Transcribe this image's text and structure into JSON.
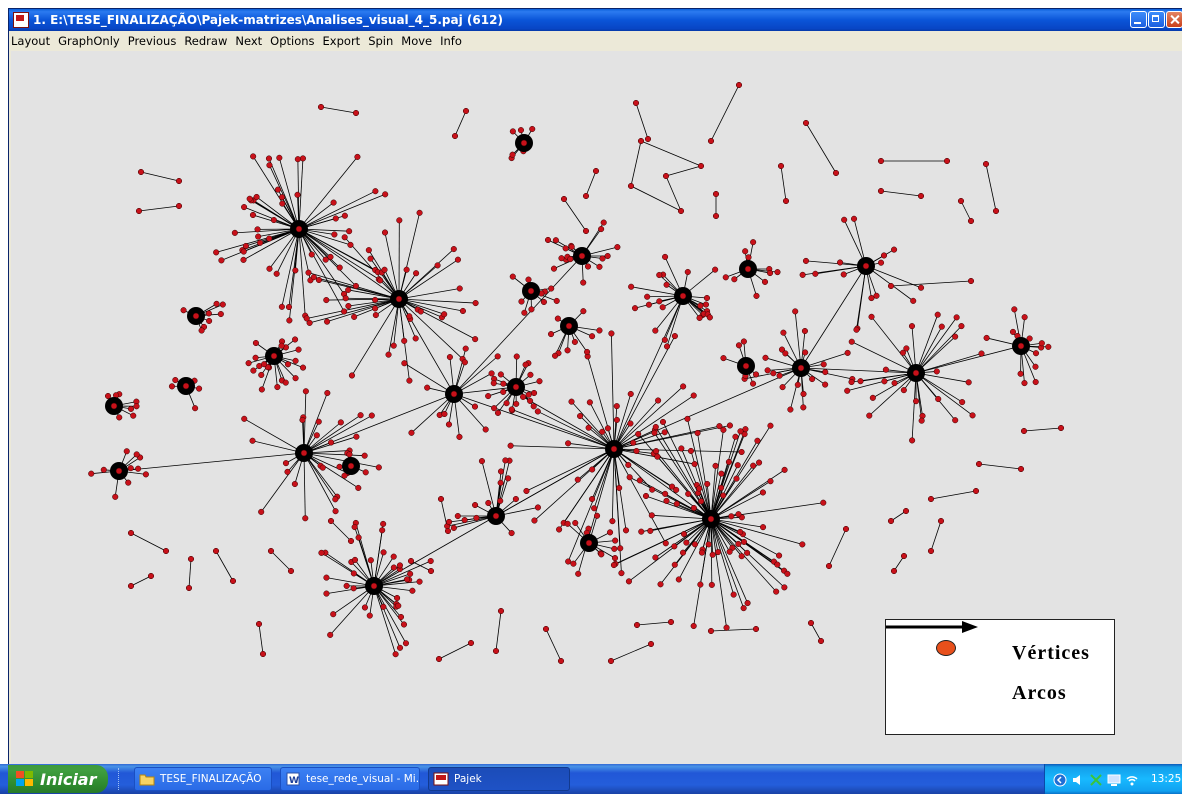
{
  "window": {
    "title": "1. E:\\TESE_FINALIZAÇÃO\\Pajek-matrizes\\Analises_visual_4_5.paj (612)"
  },
  "menu": {
    "items": [
      "Layout",
      "GraphOnly",
      "Previous",
      "Redraw",
      "Next",
      "Options",
      "Export",
      "Spin",
      "Move",
      "Info"
    ]
  },
  "legend": {
    "vertices_label": "Vértices",
    "arcs_label": "Arcos"
  },
  "taskbar": {
    "start_label": "Iniciar",
    "tasks": [
      {
        "label": "TESE_FINALIZAÇÃO",
        "icon": "folder-icon"
      },
      {
        "label": "tese_rede_visual - Mi...",
        "icon": "word-document-icon"
      },
      {
        "label": "Pajek",
        "icon": "pajek-icon"
      }
    ],
    "clock": "13:25"
  },
  "colors": {
    "vertex": "#c8111a",
    "legend_vertex": "#e8501c",
    "canvas": "#e3e3e3",
    "edge": "#000000"
  }
}
